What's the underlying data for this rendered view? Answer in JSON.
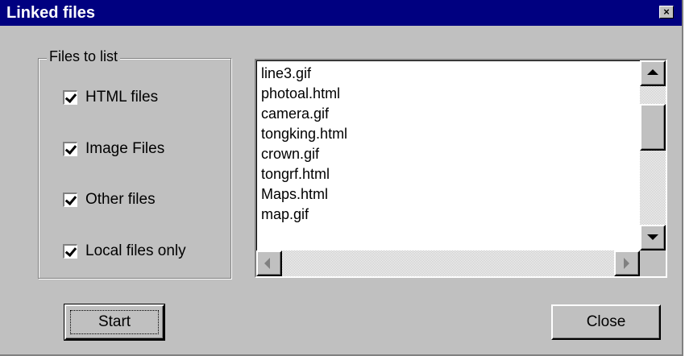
{
  "window": {
    "title": "Linked files",
    "close_glyph": "×",
    "title_bar_color": "#000080",
    "face_color": "#c0c0c0"
  },
  "files_group": {
    "legend": "Files to list",
    "options": [
      {
        "label": "HTML files",
        "checked": true
      },
      {
        "label": "Image Files",
        "checked": true
      },
      {
        "label": "Other files",
        "checked": true
      },
      {
        "label": "Local files only",
        "checked": true
      }
    ]
  },
  "file_list": {
    "items": [
      "line3.gif",
      "photoal.html",
      "camera.gif",
      "tongking.html",
      "crown.gif",
      "tongrf.html",
      "Maps.html",
      "map.gif"
    ]
  },
  "buttons": {
    "start_label": "Start",
    "close_label": "Close"
  },
  "icons": {
    "checkbox": "checkmark-icon",
    "scroll_up": "arrow-up-icon",
    "scroll_down": "arrow-down-icon",
    "scroll_left": "arrow-left-icon",
    "scroll_right": "arrow-right-icon"
  }
}
